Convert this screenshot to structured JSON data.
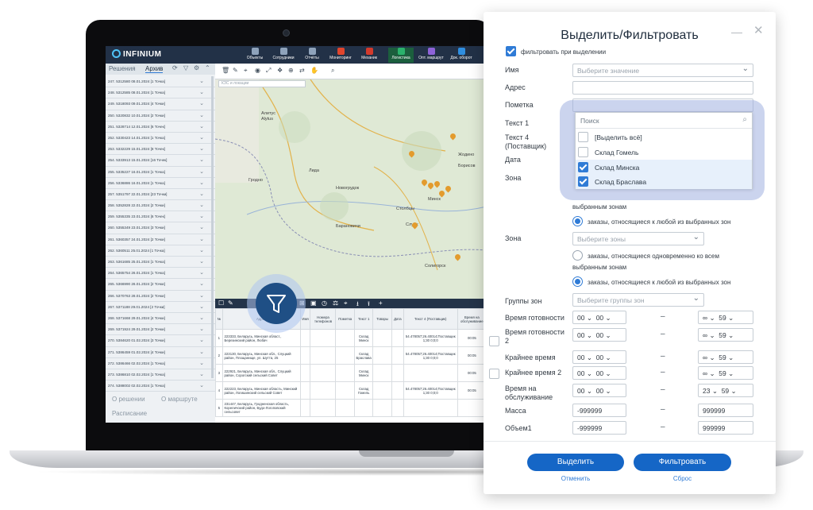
{
  "app": {
    "logo": "INFINIUM",
    "nav": [
      {
        "label": "Объекты",
        "color": "#8fa3bb"
      },
      {
        "label": "Сотрудники",
        "color": "#8fa3bb"
      },
      {
        "label": "Отчёты",
        "color": "#8fa3bb"
      },
      {
        "label": "Мониторинг",
        "color": "#e0452d"
      },
      {
        "label": "Механик",
        "color": "#d33a2c"
      },
      {
        "label": "Логистика",
        "color": "#2bb26c"
      },
      {
        "label": "Опт. маршрут",
        "color": "#8e63d8"
      },
      {
        "label": "Док. оборот",
        "color": "#2f8ee0"
      }
    ],
    "left_tabs": [
      "Решения",
      "Архив"
    ],
    "routes": [
      "247. 5312580 08.01.2024 [1 Точка]",
      "248. 5312585 08.01.2024 [1 Точка]",
      "249. 5318093 09.01.2024 [4 Точки]",
      "250. 5320832 10.01.2024 [2 Точки]",
      "251. 5328714 12.01.2024 [6 Точек]",
      "252. 5330423 14.01.2024 [1 Точка]",
      "253. 5332229 15.01.2024 [8 Точек]",
      "254. 5333913 15.01.2024 [16 Точек]",
      "255. 5335227 16.01.2024 [1 Точка]",
      "256. 5336886 16.01.2024 [1 Точка]",
      "257. 5351797 22.01.2024 [23 Точки]",
      "258. 5352828 22.01.2024 [2 Точки]",
      "259. 5355335 23.01.2024 [6 Точек]",
      "260. 5355349 23.01.2024 [3 Точки]",
      "261. 5360357 24.01.2024 [2 Точки]",
      "262. 5360511 25.01.2024 [1 Точка]",
      "263. 5361685 25.01.2024 [1 Точка]",
      "264. 5365754 26.01.2024 [1 Точка]",
      "265. 5366990 26.01.2024 [2 Точки]",
      "266. 5370763 28.01.2024 [2 Точки]",
      "267. 5371188 29.01.2024 [2 Точки]",
      "268. 5371668 29.01.2024 [4 Точки]",
      "269. 5371924 29.01.2024 [2 Точки]",
      "270. 5384620 01.02.2024 [3 Точки]",
      "271. 5386459 01.02.2024 [4 Точки]",
      "272. 5386466 02.02.2024 [1 Точка]",
      "273. 5386810 02.02.2024 [1 Точка]",
      "274. 5388002 02.02.2024 [1 Точка]"
    ],
    "left_bottom": {
      "solution": "О решении",
      "route": "О маршруте",
      "schedule": "Расписание"
    },
    "map_select_placeholder": "КЗС и локации",
    "map_labels": [
      "Алитус",
      "Alytus",
      "Гродно",
      "Лида",
      "Барановичи",
      "Слуцк",
      "Солигорск",
      "Минск",
      "Новогрудок",
      "Столбцы",
      "Борисов",
      "Жодино"
    ],
    "grid": {
      "headers": [
        "№",
        "Адрес",
        "Имя",
        "Номера телефонов",
        "Пометка",
        "Текст 1",
        "Товары",
        "Дата",
        "Текст 4 (Поставщик)",
        "Время на обслуживание"
      ],
      "rows": [
        {
          "n": "1",
          "addr": "223333, Беларусь, Минская област., Березинский район, Любач",
          "text1": "Склад Минск",
          "supplier": "54.478057;26.40014;Поставщик 1;30 0;0;0",
          "time": "00:05"
        },
        {
          "n": "2",
          "addr": "223130, Беларусь, Минская обл., Слуцкий район, Площанище, ул. Шутта, 25",
          "text1": "Склад Браслава",
          "supplier": "54.478057;26.40014;Поставщик 1;30 0;0;0",
          "time": "00:05"
        },
        {
          "n": "3",
          "addr": "222921, Беларусь, Минская обл., Слуцкий район, Сорогский сельский Совет",
          "text1": "Склад Минск",
          "supplier": "",
          "time": "00:05"
        },
        {
          "n": "4",
          "addr": "222223, Беларусь, Минская область, Минский район, Логишинский сельский Совет",
          "text1": "Склад Гомель",
          "supplier": "54.478057;26.40014;Поставщик 1;30 0;0;0",
          "time": "00:05"
        },
        {
          "n": "5",
          "addr": "231447, Беларусь, Гродненская область, Кореличский район, Будо-Логоповский сельсовет",
          "text1": "",
          "supplier": "",
          "time": ""
        }
      ]
    }
  },
  "dialog": {
    "title": "Выделить/Фильтровать",
    "filter_on_select": "фильтровать при выделении",
    "labels": {
      "name": "Имя",
      "address": "Адрес",
      "mark": "Пометка",
      "text1": "Текст 1",
      "text4": "Текст 4 (Поставщик)",
      "date": "Дата",
      "zone1": "Зона",
      "zone2": "Зона",
      "zone_groups": "Группы зон",
      "ready_time": "Время готовности",
      "ready_time2": "Время готовности 2",
      "deadline": "Крайнее время",
      "deadline2": "Крайнее время 2",
      "service_time": "Время на обслуживание",
      "mass": "Масса",
      "volume": "Объем1"
    },
    "placeholders": {
      "name": "Выберите значение",
      "zones": "Выберите зоны",
      "zone_groups": "Выберите группы зон"
    },
    "popup": {
      "search": "Поиск",
      "items": [
        {
          "label": "[Выделить всё]",
          "checked": false
        },
        {
          "label": "Склад Гомель",
          "checked": false
        },
        {
          "label": "Склад Минска",
          "checked": true
        },
        {
          "label": "Склад Браслава",
          "checked": true
        }
      ]
    },
    "zone_texts": {
      "partial_tail": "выбранным зонам",
      "any_zone": "заказы, относящиеся к любой из выбранных зон",
      "all_zones_line1": "заказы, относящиеся одновременно ко всем",
      "all_zones_line2": "выбранным зонам",
      "any_zone2": "заказы, относящиеся к любой из выбранных зон"
    },
    "times": {
      "ready": {
        "from_h": "00",
        "from_m": "00",
        "to_h": "∞",
        "to_m": "59"
      },
      "ready2": {
        "from_h": "00",
        "from_m": "00",
        "to_h": "∞",
        "to_m": "59"
      },
      "deadline": {
        "from_h": "00",
        "from_m": "00",
        "to_h": "∞",
        "to_m": "59"
      },
      "deadline2": {
        "from_h": "00",
        "from_m": "00",
        "to_h": "∞",
        "to_m": "59"
      },
      "service": {
        "from_h": "00",
        "from_m": "00",
        "to_h": "23",
        "to_m": "59"
      }
    },
    "mass": {
      "from": "-999999",
      "to": "999999"
    },
    "volume": {
      "from": "-999999",
      "to": "999999"
    },
    "dash": "–",
    "buttons": {
      "select": "Выделить",
      "filter": "Фильтровать",
      "cancel": "Отменить",
      "reset": "Сброс"
    }
  }
}
